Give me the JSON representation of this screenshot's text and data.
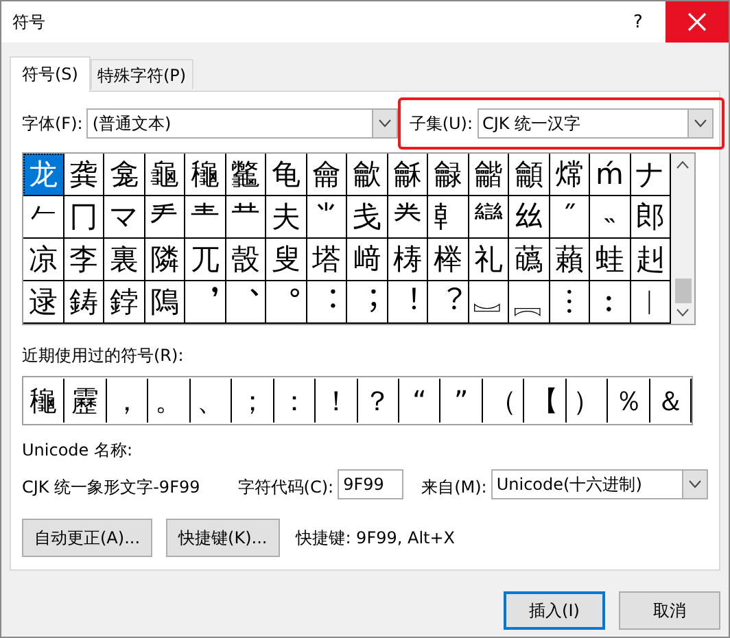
{
  "window": {
    "title": "符号",
    "help": "?"
  },
  "tabs": [
    {
      "label": "符号(S)",
      "selected": true
    },
    {
      "label": "特殊字符(P)",
      "selected": false
    }
  ],
  "font": {
    "label": "字体(F):",
    "value": "(普通文本)"
  },
  "subset": {
    "label": "子集(U):",
    "value": "CJK 统一汉字",
    "highlighted": true
  },
  "symbols": {
    "rows": [
      [
        {
          "char": "龙",
          "selected": true
        },
        {
          "char": "龚",
          "selected": false
        },
        {
          "char": "龛",
          "selected": false
        },
        {
          "char": "龜",
          "selected": false
        },
        {
          "char": "龝",
          "selected": false
        },
        {
          "char": "龞",
          "selected": false
        },
        {
          "char": "龟",
          "selected": false
        },
        {
          "char": "龠",
          "selected": false
        },
        {
          "char": "龡",
          "selected": false
        },
        {
          "char": "龢",
          "selected": false
        },
        {
          "char": "龣",
          "selected": false
        },
        {
          "char": "龤",
          "selected": false
        },
        {
          "char": "龥",
          "selected": false
        },
        {
          "char": "龦",
          "selected": false
        },
        {
          "char": "ḿ",
          "selected": false
        },
        {
          "char": "ナ",
          "selected": false
        }
      ],
      [
        {
          "char": "𠂉",
          "selected": false
        },
        {
          "char": "冂",
          "selected": false
        },
        {
          "char": "マ",
          "selected": false
        },
        {
          "char": "龵",
          "selected": false
        },
        {
          "char": "龶",
          "selected": false
        },
        {
          "char": "龷",
          "selected": false
        },
        {
          "char": "夫",
          "selected": false
        },
        {
          "char": "⺌",
          "selected": false
        },
        {
          "char": "戋",
          "selected": false
        },
        {
          "char": "龹",
          "selected": false
        },
        {
          "char": "龺",
          "selected": false
        },
        {
          "char": "龻",
          "selected": false
        },
        {
          "char": "𢆶",
          "selected": false
        },
        {
          "char": "˝",
          "selected": false
        },
        {
          "char": "˵",
          "selected": false
        },
        {
          "char": "郎",
          "selected": false
        }
      ],
      [
        {
          "char": "凉",
          "selected": false
        },
        {
          "char": "李",
          "selected": false
        },
        {
          "char": "裏",
          "selected": false
        },
        {
          "char": "隣",
          "selected": false
        },
        {
          "char": "兀",
          "selected": false
        },
        {
          "char": "嗀",
          "selected": false
        },
        {
          "char": "叟",
          "selected": false
        },
        {
          "char": "塔",
          "selected": false
        },
        {
          "char": "﨑",
          "selected": false
        },
        {
          "char": "梼",
          "selected": false
        },
        {
          "char": "榉",
          "selected": false
        },
        {
          "char": "礼",
          "selected": false
        },
        {
          "char": "蘤",
          "selected": false
        },
        {
          "char": "藾",
          "selected": false
        },
        {
          "char": "蛙",
          "selected": false
        },
        {
          "char": "赳",
          "selected": false
        }
      ],
      [
        {
          "char": "逯",
          "selected": false
        },
        {
          "char": "鋳",
          "selected": false
        },
        {
          "char": "鋍",
          "selected": false
        },
        {
          "char": "隝",
          "selected": false
        },
        {
          "char": "︐",
          "selected": false
        },
        {
          "char": "︑",
          "selected": false
        },
        {
          "char": "︒",
          "selected": false
        },
        {
          "char": "︓",
          "selected": false
        },
        {
          "char": "︔",
          "selected": false
        },
        {
          "char": "︕",
          "selected": false
        },
        {
          "char": "︖",
          "selected": false
        },
        {
          "char": "︗",
          "selected": false
        },
        {
          "char": "︘",
          "selected": false
        },
        {
          "char": "︙",
          "selected": false
        },
        {
          "char": "︰",
          "selected": false
        },
        {
          "char": "︱",
          "selected": false
        }
      ]
    ]
  },
  "recent": {
    "label": "近期使用过的符号(R):",
    "items": [
      "龝",
      "靂",
      "，",
      "。",
      "、",
      "；",
      "：",
      "！",
      "？",
      "“",
      "”",
      "（",
      "【",
      "）",
      "％",
      "＆"
    ]
  },
  "unicode_name": {
    "label": "Unicode 名称:",
    "value": "CJK 统一象形文字-9F99"
  },
  "char_code": {
    "label": "字符代码(C):",
    "value": "9F99"
  },
  "from": {
    "label": "来自(M):",
    "value": "Unicode(十六进制)"
  },
  "tools": [
    "自动更正(A)...",
    "快捷键(K)..."
  ],
  "shortcut": "快捷键: 9F99, Alt+X",
  "buttons": [
    {
      "label": "插入(I)",
      "default": true
    },
    {
      "label": "取消",
      "default": false
    }
  ]
}
